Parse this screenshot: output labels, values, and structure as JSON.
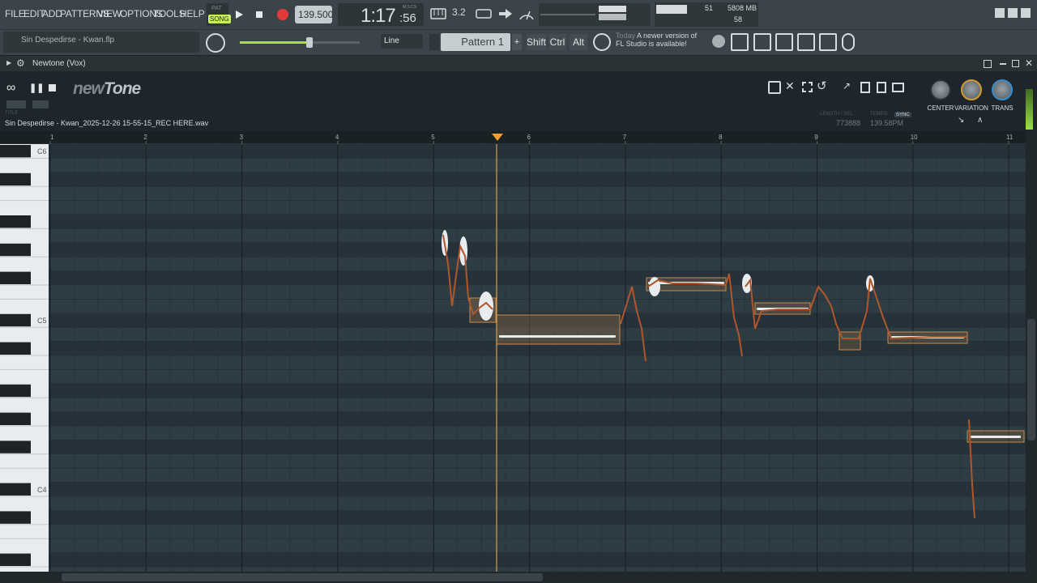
{
  "menu": [
    "FILE",
    "EDIT",
    "ADD",
    "PATTERNS",
    "VIEW",
    "OPTIONS",
    "TOOLS",
    "HELP"
  ],
  "transport": {
    "pat_label": "PAT",
    "song_label": "SONG",
    "tempo": "139.500",
    "time": "1:17",
    "time_small": ":56",
    "time_caption": "M:S:CS",
    "rate_label": "3.2"
  },
  "cpu": {
    "value1": "51",
    "memory": "5808 MB",
    "value2": "58"
  },
  "project_file": "Sin Despedirse - Kwan.flp",
  "snap_mode": "Line",
  "pattern": "Pattern 1",
  "modifiers": [
    "Shift",
    "Ctrl",
    "Alt"
  ],
  "hint": {
    "today": "Today",
    "line1": "A newer version of",
    "line2": "FL Studio is available!"
  },
  "plugin": {
    "title": "Newtone (Vox)"
  },
  "newtone": {
    "logo_new": "new",
    "logo_tone": "Tone",
    "title_caption": "TITLE",
    "filename": "Sin Despedirse - Kwan_2025-12-26 15-55-15_REC HERE.wav",
    "length_caption": "LENGTH / SEL",
    "length_value": "773888",
    "tempo_caption": "TEMPO",
    "tempo_value": "139.58PM",
    "sync_label": "SYNC",
    "knobs": [
      "CENTER",
      "VARIATION",
      "TRANS"
    ]
  },
  "ruler": [
    "1",
    "2",
    "3",
    "4",
    "5",
    "6",
    "7",
    "8",
    "9",
    "10",
    "11"
  ],
  "piano_labels": {
    "c6": "C6",
    "c5": "C5",
    "c4": "C4"
  },
  "colors": {
    "accent": "#f0a030",
    "note_fill": "#c98a4b",
    "record": "#e23a3a",
    "song_led": "#c8f05a"
  },
  "icons": [
    "infinity-icon",
    "pause-icon",
    "stop-icon",
    "save-icon",
    "cut-icon",
    "select-icon",
    "reset-icon",
    "play-icon",
    "record-icon",
    "metronome-icon",
    "mixer-icon",
    "piano-roll-icon",
    "channel-rack-icon",
    "browser-icon",
    "plugin-icon",
    "microphone-icon"
  ]
}
